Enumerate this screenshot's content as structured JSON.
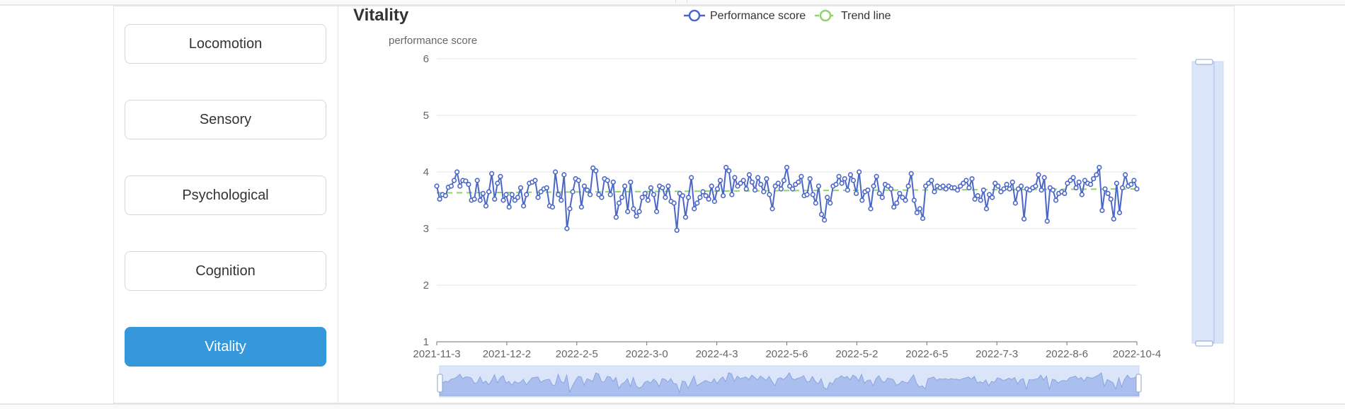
{
  "sidebar": {
    "items": [
      {
        "label": "Locomotion",
        "active": false
      },
      {
        "label": "Sensory",
        "active": false
      },
      {
        "label": "Psychological",
        "active": false
      },
      {
        "label": "Cognition",
        "active": false
      },
      {
        "label": "Vitality",
        "active": true
      }
    ]
  },
  "chart": {
    "title": "Vitality",
    "legend": [
      "Performance score",
      "Trend line"
    ],
    "colors": {
      "series": "#4a66c9",
      "trend": "#8fd16b",
      "accent": "#3498db"
    }
  },
  "chart_data": {
    "type": "line",
    "title": "Vitality",
    "xlabel": "",
    "ylabel": "performance score",
    "ylim": [
      1,
      6
    ],
    "yticks": [
      "1",
      "2",
      "3",
      "4",
      "5",
      "6"
    ],
    "xticks": [
      "2021-11-3",
      "2021-12-2",
      "2022-2-5",
      "2022-3-0",
      "2022-4-3",
      "2022-5-6",
      "2022-5-2",
      "2022-6-5",
      "2022-7-3",
      "2022-8-6",
      "2022-10-4"
    ],
    "grid": true,
    "legend_position": "top-center",
    "series": [
      {
        "name": "Performance score",
        "values": [
          3.75,
          3.52,
          3.6,
          3.58,
          3.73,
          3.75,
          3.85,
          4.0,
          3.75,
          3.85,
          3.84,
          3.78,
          3.5,
          3.52,
          3.85,
          3.5,
          3.62,
          3.4,
          3.65,
          3.97,
          3.52,
          3.8,
          3.92,
          3.5,
          3.6,
          3.38,
          3.6,
          3.5,
          3.55,
          3.72,
          3.4,
          3.6,
          3.8,
          3.82,
          3.85,
          3.55,
          3.65,
          3.7,
          3.72,
          3.4,
          3.38,
          4.0,
          3.6,
          3.5,
          3.95,
          3.0,
          3.35,
          3.65,
          3.88,
          3.85,
          3.38,
          3.75,
          3.68,
          3.6,
          4.07,
          4.02,
          3.6,
          3.55,
          3.88,
          3.85,
          3.6,
          3.82,
          3.2,
          3.45,
          3.55,
          3.75,
          3.3,
          3.82,
          3.35,
          3.22,
          3.3,
          3.55,
          3.62,
          3.5,
          3.72,
          3.6,
          3.3,
          3.75,
          3.72,
          3.55,
          3.75,
          3.48,
          3.45,
          2.97,
          3.62,
          3.58,
          3.2,
          3.55,
          3.9,
          3.35,
          3.45,
          3.55,
          3.65,
          3.58,
          3.52,
          3.75,
          3.48,
          3.7,
          3.85,
          3.58,
          4.08,
          4.02,
          3.6,
          3.9,
          3.75,
          3.8,
          3.85,
          3.7,
          3.95,
          3.82,
          3.68,
          3.9,
          3.78,
          3.65,
          3.88,
          3.6,
          3.35,
          3.75,
          3.8,
          3.7,
          3.85,
          4.08,
          3.75,
          3.7,
          3.78,
          3.82,
          3.92,
          3.58,
          3.6,
          3.88,
          3.6,
          3.45,
          3.75,
          3.25,
          3.15,
          3.55,
          3.45,
          3.75,
          3.78,
          3.92,
          3.8,
          3.88,
          3.68,
          3.95,
          3.85,
          3.62,
          4.0,
          3.5,
          3.65,
          3.68,
          3.35,
          3.75,
          3.92,
          3.62,
          3.55,
          3.78,
          3.75,
          3.7,
          3.38,
          3.45,
          3.62,
          3.55,
          3.5,
          3.75,
          3.97,
          3.5,
          3.28,
          3.35,
          3.18,
          3.75,
          3.8,
          3.85,
          3.65,
          3.75,
          3.72,
          3.75,
          3.7,
          3.75,
          3.72,
          3.72,
          3.68,
          3.75,
          3.8,
          3.85,
          3.72,
          3.88,
          3.52,
          3.58,
          3.5,
          3.68,
          3.35,
          3.6,
          3.55,
          3.8,
          3.75,
          3.65,
          3.7,
          3.78,
          3.7,
          3.82,
          3.45,
          3.7,
          3.75,
          3.17,
          3.7,
          3.68,
          3.72,
          3.75,
          3.95,
          3.68,
          3.9,
          3.13,
          3.72,
          3.68,
          3.5,
          3.62,
          3.65,
          3.62,
          3.8,
          3.85,
          3.9,
          3.72,
          3.82,
          3.6,
          3.85,
          3.8,
          3.78,
          3.88,
          3.95,
          4.08,
          3.32,
          3.7,
          3.62,
          3.52,
          3.17,
          3.8,
          3.28,
          3.72,
          3.95,
          3.75,
          3.78,
          3.85,
          3.7
        ]
      },
      {
        "name": "Trend line",
        "values": [
          3.63,
          3.67,
          3.7
        ]
      }
    ]
  }
}
